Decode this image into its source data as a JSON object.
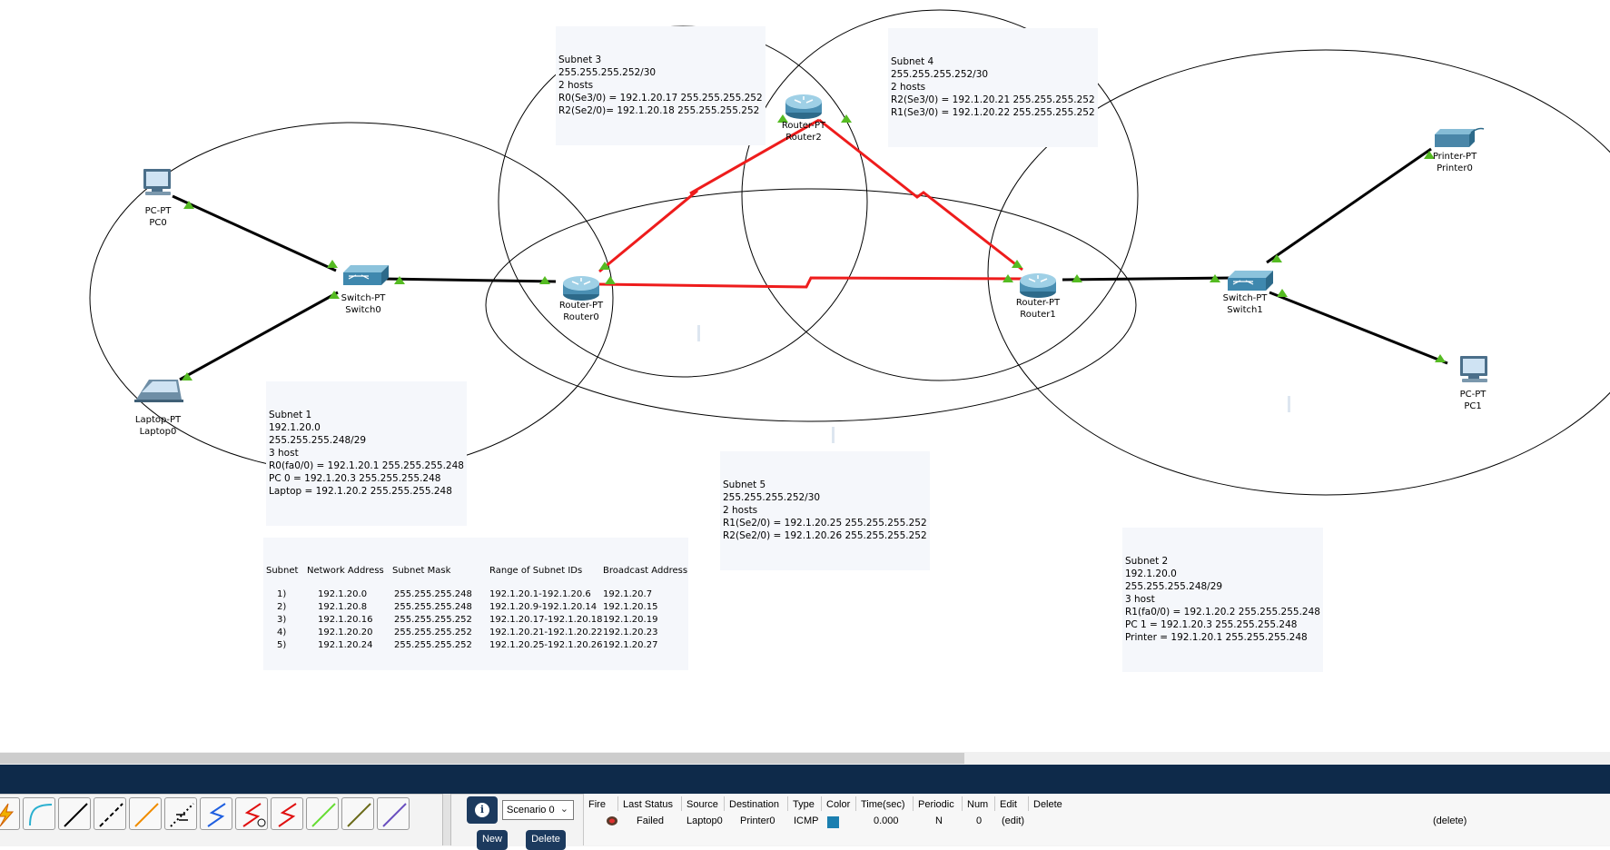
{
  "notes": {
    "subnet3": [
      "Subnet 3",
      "255.255.255.252/30",
      "2 hosts",
      "R0(Se3/0) = 192.1.20.17 255.255.255.252",
      "R2(Se2/0)= 192.1.20.18 255.255.255.252"
    ],
    "subnet4": [
      "Subnet 4",
      "255.255.255.252/30",
      "2 hosts",
      "R2(Se3/0) = 192.1.20.21 255.255.255.252",
      "R1(Se3/0) = 192.1.20.22 255.255.255.252"
    ],
    "subnet1": [
      "Subnet 1",
      "192.1.20.0",
      "255.255.255.248/29",
      "3 host",
      "R0(fa0/0) = 192.1.20.1 255.255.255.248",
      "PC 0 = 192.1.20.3 255.255.255.248",
      "Laptop = 192.1.20.2 255.255.255.248"
    ],
    "subnet5": [
      "Subnet 5",
      "255.255.255.252/30",
      "2 hosts",
      "R1(Se2/0) = 192.1.20.25 255.255.255.252",
      "R2(Se2/0) = 192.1.20.26 255.255.255.252"
    ],
    "subnet2": [
      "Subnet 2",
      "192.1.20.0",
      "255.255.255.248/29",
      "3 host",
      "R1(fa0/0) = 192.1.20.2 255.255.255.248",
      "PC 1 = 192.1.20.3 255.255.255.248",
      "Printer = 192.1.20.1 255.255.255.248"
    ]
  },
  "devices": {
    "pc0": {
      "type": "PC-PT",
      "name": "PC0"
    },
    "laptop0": {
      "type": "Laptop-PT",
      "name": "Laptop0"
    },
    "switch0": {
      "type": "Switch-PT",
      "name": "Switch0"
    },
    "router0": {
      "type": "Router-PT",
      "name": "Router0"
    },
    "router2": {
      "type": "Router-PT",
      "name": "Router2"
    },
    "router1": {
      "type": "Router-PT",
      "name": "Router1"
    },
    "switch1": {
      "type": "Switch-PT",
      "name": "Switch1"
    },
    "printer0": {
      "type": "Printer-PT",
      "name": "Printer0"
    },
    "pc1": {
      "type": "PC-PT",
      "name": "PC1"
    }
  },
  "subnet_table": {
    "headers": [
      "Subnet",
      "Network Address",
      "Subnet Mask",
      "Range of Subnet IDs",
      "Broadcast Address"
    ],
    "rows": [
      [
        "1)",
        "192.1.20.0",
        "255.255.255.248",
        "192.1.20.1-192.1.20.6",
        "192.1.20.7"
      ],
      [
        "2)",
        "192.1.20.8",
        "255.255.255.248",
        "192.1.20.9-192.1.20.14",
        "192.1.20.15"
      ],
      [
        "3)",
        "192.1.20.16",
        "255.255.255.252",
        "192.1.20.17-192.1.20.18",
        "192.1.20.19"
      ],
      [
        "4)",
        "192.1.20.20",
        "255.255.255.252",
        "192.1.20.21-192.1.20.22",
        "192.1.20.23"
      ],
      [
        "5)",
        "192.1.20.24",
        "255.255.255.252",
        "192.1.20.25-192.1.20.26",
        "192.1.20.27"
      ]
    ]
  },
  "connection_tools": [
    {
      "name": "lightning-auto-connection-icon",
      "color": "#e8a000"
    },
    {
      "name": "console-cable-icon",
      "color": "#2ab0d0"
    },
    {
      "name": "copper-straight-through-icon",
      "color": "#000000"
    },
    {
      "name": "copper-cross-over-icon",
      "color": "#000000"
    },
    {
      "name": "fiber-icon",
      "color": "#f08c00"
    },
    {
      "name": "phone-cable-icon",
      "color": "#000000"
    },
    {
      "name": "coaxial-cable-icon",
      "color": "#1f5fe0"
    },
    {
      "name": "serial-dce-icon",
      "color": "#e01010"
    },
    {
      "name": "serial-dte-icon",
      "color": "#e01010"
    },
    {
      "name": "octal-cable-icon",
      "color": "#66dd33"
    },
    {
      "name": "iot-custom-cable-icon",
      "color": "#6b6b1a"
    },
    {
      "name": "usb-cable-icon",
      "color": "#6a4fbf"
    }
  ],
  "scenario": {
    "selected": "Scenario 0",
    "new_label": "New",
    "delete_label": "Delete"
  },
  "pdu_list": {
    "headers": [
      "Fire",
      "Last Status",
      "Source",
      "Destination",
      "Type",
      "Color",
      "Time(sec)",
      "Periodic",
      "Num",
      "Edit",
      "Delete"
    ],
    "row": {
      "status": "Failed",
      "source": "Laptop0",
      "destination": "Printer0",
      "type": "ICMP",
      "color": "#1b7fb0",
      "time": "0.000",
      "periodic": "N",
      "num": "0",
      "edit": "(edit)",
      "delete": "(delete)"
    }
  },
  "colors": {
    "serial_link": "#ee1c1c",
    "ethernet_link": "#000000",
    "link_up": "#55bb22",
    "bottom_bar": "#0e2a4a"
  }
}
